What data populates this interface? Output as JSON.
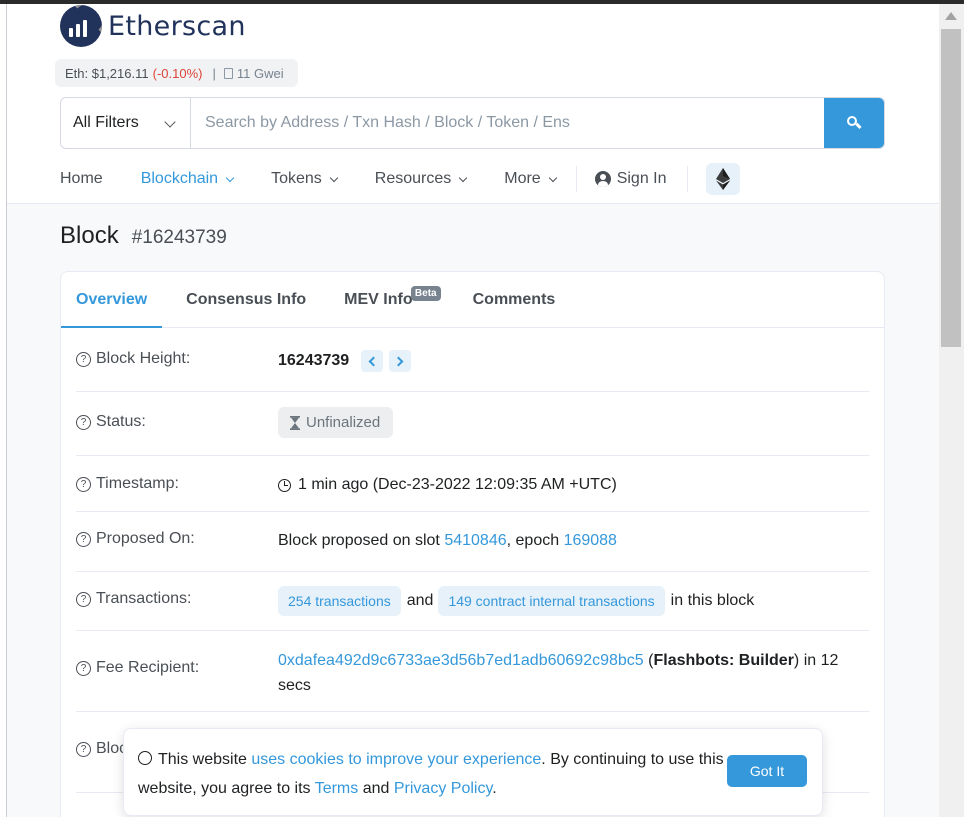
{
  "brand": {
    "name": "Etherscan"
  },
  "price_bar": {
    "eth_label": "Eth: $1,216.11",
    "change": "(-0.10%)",
    "separator": "|",
    "gas": "11 Gwei"
  },
  "search": {
    "filter_label": "All Filters",
    "placeholder": "Search by Address / Txn Hash / Block / Token / Ens"
  },
  "nav": {
    "home": "Home",
    "blockchain": "Blockchain",
    "tokens": "Tokens",
    "resources": "Resources",
    "more": "More",
    "sign_in": "Sign In"
  },
  "page": {
    "title": "Block",
    "block_number": "#16243739"
  },
  "tabs": {
    "overview": "Overview",
    "consensus": "Consensus Info",
    "mev": "MEV Info",
    "mev_badge": "Beta",
    "comments": "Comments"
  },
  "details": {
    "block_height": {
      "label": "Block Height:",
      "value": "16243739"
    },
    "status": {
      "label": "Status:",
      "value": "Unfinalized"
    },
    "timestamp": {
      "label": "Timestamp:",
      "value": "1 min ago (Dec-23-2022 12:09:35 AM +UTC)"
    },
    "proposed_on": {
      "label": "Proposed On:",
      "prefix": "Block proposed on slot",
      "slot": "5410846",
      "mid": ", epoch",
      "epoch": "169088"
    },
    "transactions": {
      "label": "Transactions:",
      "txns": "254 transactions",
      "and": "and",
      "internal": "149 contract internal transactions",
      "suffix": "in this block"
    },
    "fee_recipient": {
      "label": "Fee Recipient:",
      "address": "0xdafea492d9c6733ae3d56b7ed1adb60692c98bc5",
      "open_paren": "(",
      "name": "Flashbots: Builder",
      "close_suffix": ") in 12",
      "secs": "secs"
    },
    "next_label": "Bloc"
  },
  "cookie": {
    "text1": "This website",
    "link1": "uses cookies to improve your experience",
    "text2": ". By continuing to use this website, you agree to its",
    "terms": "Terms",
    "and": "and",
    "privacy": "Privacy Policy",
    "end": ".",
    "button": "Got It"
  },
  "colors": {
    "accent": "#3498db",
    "brand_navy": "#21325b",
    "negative": "#de4437"
  }
}
